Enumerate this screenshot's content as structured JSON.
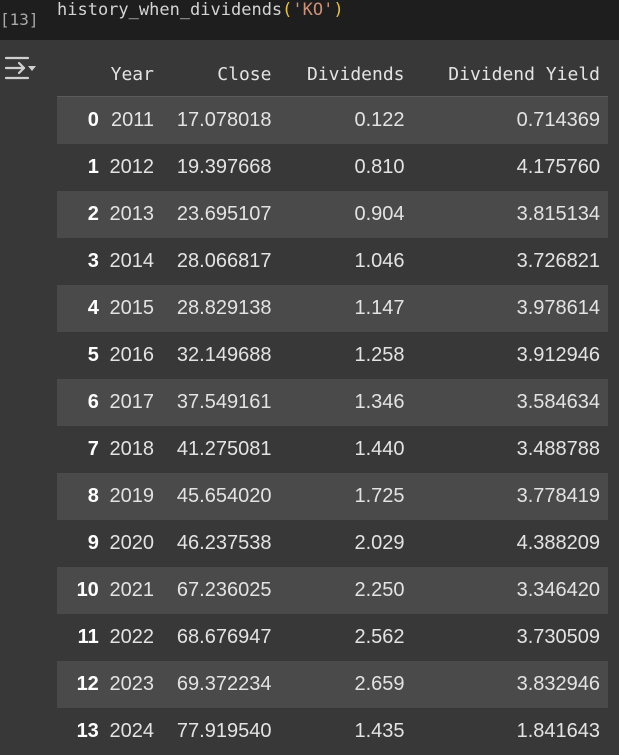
{
  "cell": {
    "execution_count": "[13]",
    "code_func": "history_when_dividends",
    "code_open": "(",
    "code_arg": "'KO'",
    "code_close": ")"
  },
  "output": {
    "toggle_icon": "output-collapse-icon",
    "table": {
      "columns": [
        "Year",
        "Close",
        "Dividends",
        "Dividend Yield"
      ],
      "rows": [
        {
          "index": "0",
          "year": "2011",
          "close": "17.078018",
          "dividends": "0.122",
          "yield": "0.714369"
        },
        {
          "index": "1",
          "year": "2012",
          "close": "19.397668",
          "dividends": "0.810",
          "yield": "4.175760"
        },
        {
          "index": "2",
          "year": "2013",
          "close": "23.695107",
          "dividends": "0.904",
          "yield": "3.815134"
        },
        {
          "index": "3",
          "year": "2014",
          "close": "28.066817",
          "dividends": "1.046",
          "yield": "3.726821"
        },
        {
          "index": "4",
          "year": "2015",
          "close": "28.829138",
          "dividends": "1.147",
          "yield": "3.978614"
        },
        {
          "index": "5",
          "year": "2016",
          "close": "32.149688",
          "dividends": "1.258",
          "yield": "3.912946"
        },
        {
          "index": "6",
          "year": "2017",
          "close": "37.549161",
          "dividends": "1.346",
          "yield": "3.584634"
        },
        {
          "index": "7",
          "year": "2018",
          "close": "41.275081",
          "dividends": "1.440",
          "yield": "3.488788"
        },
        {
          "index": "8",
          "year": "2019",
          "close": "45.654020",
          "dividends": "1.725",
          "yield": "3.778419"
        },
        {
          "index": "9",
          "year": "2020",
          "close": "46.237538",
          "dividends": "2.029",
          "yield": "4.388209"
        },
        {
          "index": "10",
          "year": "2021",
          "close": "67.236025",
          "dividends": "2.250",
          "yield": "3.346420"
        },
        {
          "index": "11",
          "year": "2022",
          "close": "68.676947",
          "dividends": "2.562",
          "yield": "3.730509"
        },
        {
          "index": "12",
          "year": "2023",
          "close": "69.372234",
          "dividends": "2.659",
          "yield": "3.832946"
        },
        {
          "index": "13",
          "year": "2024",
          "close": "77.919540",
          "dividends": "1.435",
          "yield": "1.841643"
        }
      ]
    }
  },
  "colors": {
    "code_bg": "#1e1e1e",
    "output_bg": "#383838",
    "row_stripe": "#4a4a4a",
    "paren": "#e8c33b",
    "string": "#ce9178"
  }
}
